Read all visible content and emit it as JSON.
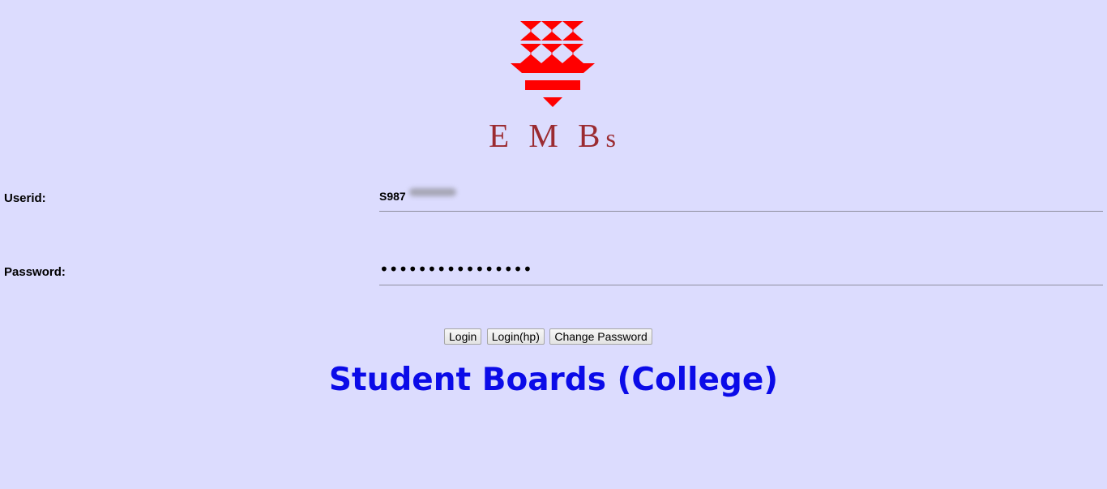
{
  "logo": {
    "icon": "emb-torch-icon",
    "color": "#ff0000",
    "brand_text_large": "E M B",
    "brand_text_small": "s",
    "brand_color": "#9b2b31"
  },
  "form": {
    "userid_label": "Userid:",
    "userid_value": "S987",
    "password_label": "Password:",
    "password_value": "password12345678"
  },
  "buttons": {
    "login": "Login",
    "login_hp": "Login(hp)",
    "change_password": "Change Password"
  },
  "heading": {
    "title": "Student Boards (College)",
    "color": "#0b0be8"
  },
  "theme": {
    "background": "#dcdcfe"
  }
}
